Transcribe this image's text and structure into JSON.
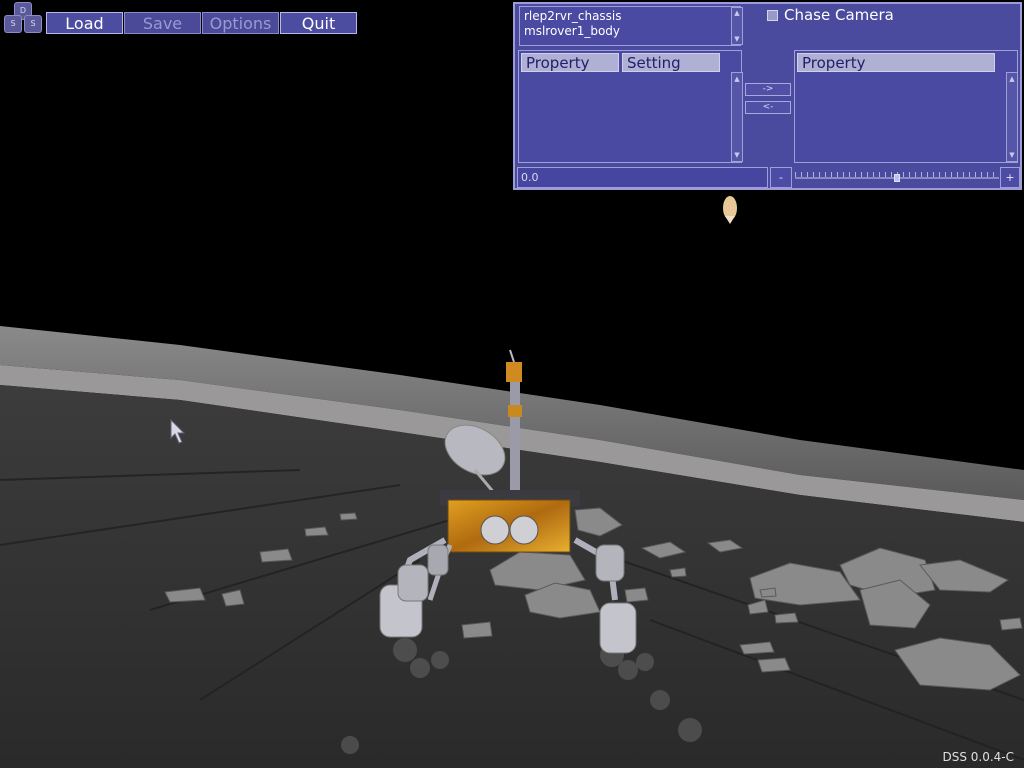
{
  "logo": {
    "letters": [
      "D",
      "S",
      "S"
    ]
  },
  "menu": {
    "load": "Load",
    "save": "Save",
    "options": "Options",
    "quit": "Quit"
  },
  "panel": {
    "object_list": [
      "rlep2rvr_chassis",
      "mslrover1_body"
    ],
    "chase_camera_label": "Chase Camera",
    "chase_camera_checked": false,
    "left_table": {
      "col1": "Property",
      "col2": "Setting"
    },
    "right_table": {
      "col1": "Property"
    },
    "move_right_label": "->",
    "move_left_label": "<-",
    "value_field": "0.0",
    "minus_label": "-",
    "plus_label": "+",
    "slider_fraction": 0.5
  },
  "version": "DSS 0.0.4-C",
  "colors": {
    "panel_bg": "#4a4a9e",
    "panel_border": "#9c9cd8",
    "button_bg": "#4c4ca0",
    "sky": "#000000",
    "ground": "#3a3a3a"
  }
}
